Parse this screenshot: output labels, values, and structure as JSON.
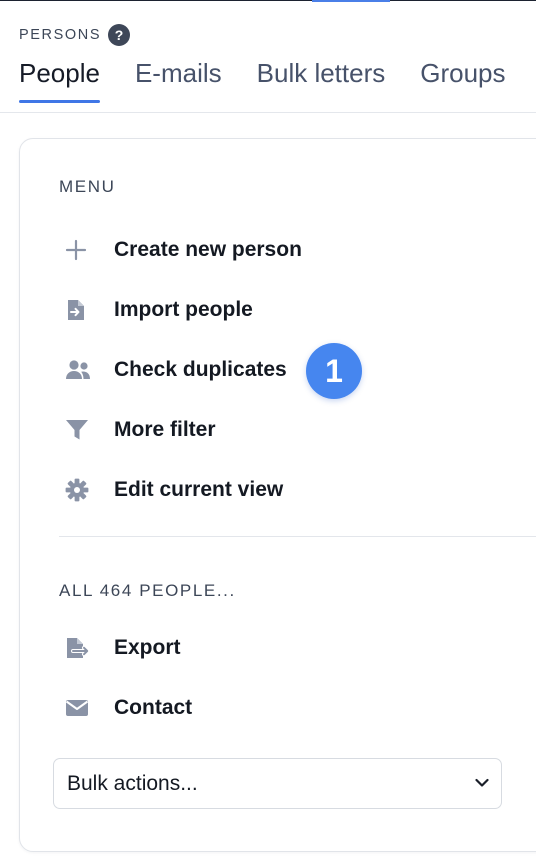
{
  "header": {
    "section_label": "PERSONS",
    "help_glyph": "?",
    "tabs": [
      {
        "label": "People",
        "active": true
      },
      {
        "label": "E-mails",
        "active": false
      },
      {
        "label": "Bulk letters",
        "active": false
      },
      {
        "label": "Groups",
        "active": false
      }
    ]
  },
  "menu": {
    "heading": "MENU",
    "items": [
      {
        "label": "Create new person",
        "icon": "plus-icon"
      },
      {
        "label": "Import people",
        "icon": "file-import-icon"
      },
      {
        "label": "Check duplicates",
        "icon": "users-icon"
      },
      {
        "label": "More filter",
        "icon": "filter-icon"
      },
      {
        "label": "Edit current view",
        "icon": "gear-icon"
      }
    ]
  },
  "badge": {
    "text": "1"
  },
  "all_people": {
    "heading": "ALL 464 PEOPLE...",
    "items": [
      {
        "label": "Export",
        "icon": "file-export-icon"
      },
      {
        "label": "Contact",
        "icon": "envelope-icon"
      }
    ]
  },
  "bulk_select": {
    "value": "Bulk actions..."
  },
  "colors": {
    "accent": "#3f76e6",
    "badge": "#4686ef",
    "icon": "#8a93a6",
    "text": "#141922"
  }
}
